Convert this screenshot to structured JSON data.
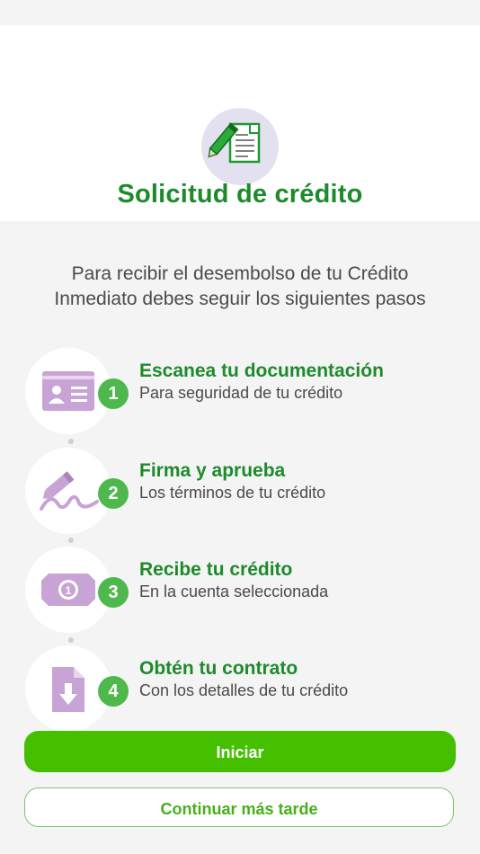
{
  "header": {
    "title": "Solicitud de crédito",
    "icon": "document-pen-icon"
  },
  "intro": "Para recibir el desembolso de tu Crédito Inmediato debes seguir los siguientes pasos",
  "steps": [
    {
      "number": "1",
      "title": "Escanea tu documentación",
      "subtitle": "Para seguridad de tu crédito",
      "icon": "id-card-icon"
    },
    {
      "number": "2",
      "title": "Firma y aprueba",
      "subtitle": "Los términos de tu crédito",
      "icon": "signature-pen-icon"
    },
    {
      "number": "3",
      "title": "Recibe tu crédito",
      "subtitle": "En la cuenta seleccionada",
      "icon": "banknote-icon"
    },
    {
      "number": "4",
      "title": "Obtén tu contrato",
      "subtitle": "Con los detalles de tu crédito",
      "icon": "download-document-icon"
    }
  ],
  "buttons": {
    "start": "Iniciar",
    "later": "Continuar más tarde"
  },
  "colors": {
    "primary_green": "#45c000",
    "title_green": "#1d8a2c",
    "badge_green": "#4fb84c",
    "icon_purple": "#c7a3d6"
  }
}
